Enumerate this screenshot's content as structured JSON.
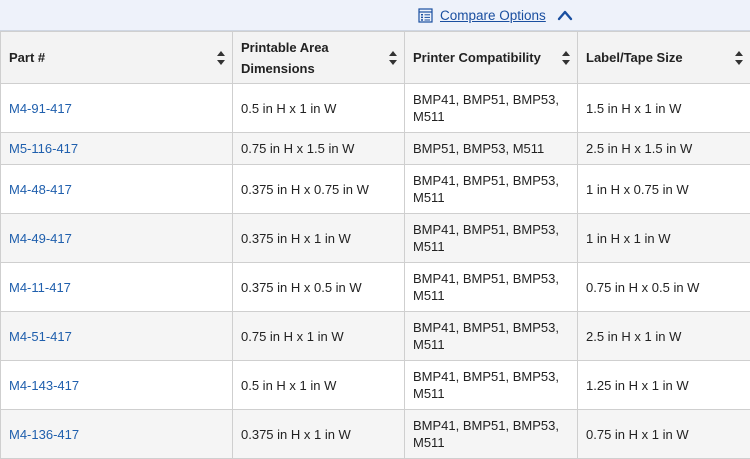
{
  "toolbar": {
    "compare_label": "Compare Options"
  },
  "table": {
    "headers": [
      "Part #",
      "Printable Area Dimensions",
      "Printer Compatibility",
      "Label/Tape Size"
    ],
    "rows": [
      {
        "part": "M4-91-417",
        "area": "0.5 in H x 1 in W",
        "printers": "BMP41, BMP51, BMP53, M511",
        "size": "1.5 in H x 1 in W"
      },
      {
        "part": "M5-116-417",
        "area": "0.75 in H x 1.5 in W",
        "printers": "BMP51, BMP53, M511",
        "size": "2.5 in H x 1.5 in W"
      },
      {
        "part": "M4-48-417",
        "area": "0.375 in H x 0.75 in W",
        "printers": "BMP41, BMP51, BMP53, M511",
        "size": "1 in H x 0.75 in W"
      },
      {
        "part": "M4-49-417",
        "area": "0.375 in H x 1 in W",
        "printers": "BMP41, BMP51, BMP53, M511",
        "size": "1 in H x 1 in W"
      },
      {
        "part": "M4-11-417",
        "area": "0.375 in H x 0.5 in W",
        "printers": "BMP41, BMP51, BMP53, M511",
        "size": "0.75 in H x 0.5 in W"
      },
      {
        "part": "M4-51-417",
        "area": "0.75 in H x 1 in W",
        "printers": "BMP41, BMP51, BMP53, M511",
        "size": "2.5 in H x 1 in W"
      },
      {
        "part": "M4-143-417",
        "area": "0.5 in H x 1 in W",
        "printers": "BMP41, BMP51, BMP53, M511",
        "size": "1.25 in H x 1 in W"
      },
      {
        "part": "M4-136-417",
        "area": "0.375 in H x 1 in W",
        "printers": "BMP41, BMP51, BMP53, M511",
        "size": "0.75 in H x 1 in W"
      }
    ]
  },
  "colors": {
    "link": "#1f5fad",
    "header_bg": "#f3f3f3",
    "alt_row_bg": "#f5f5f5",
    "topbar_bg": "#eef2fa"
  },
  "icons": {
    "compare": "compare-list-icon",
    "collapse": "chevron-up-icon",
    "sort": "sort-updown-icon"
  }
}
